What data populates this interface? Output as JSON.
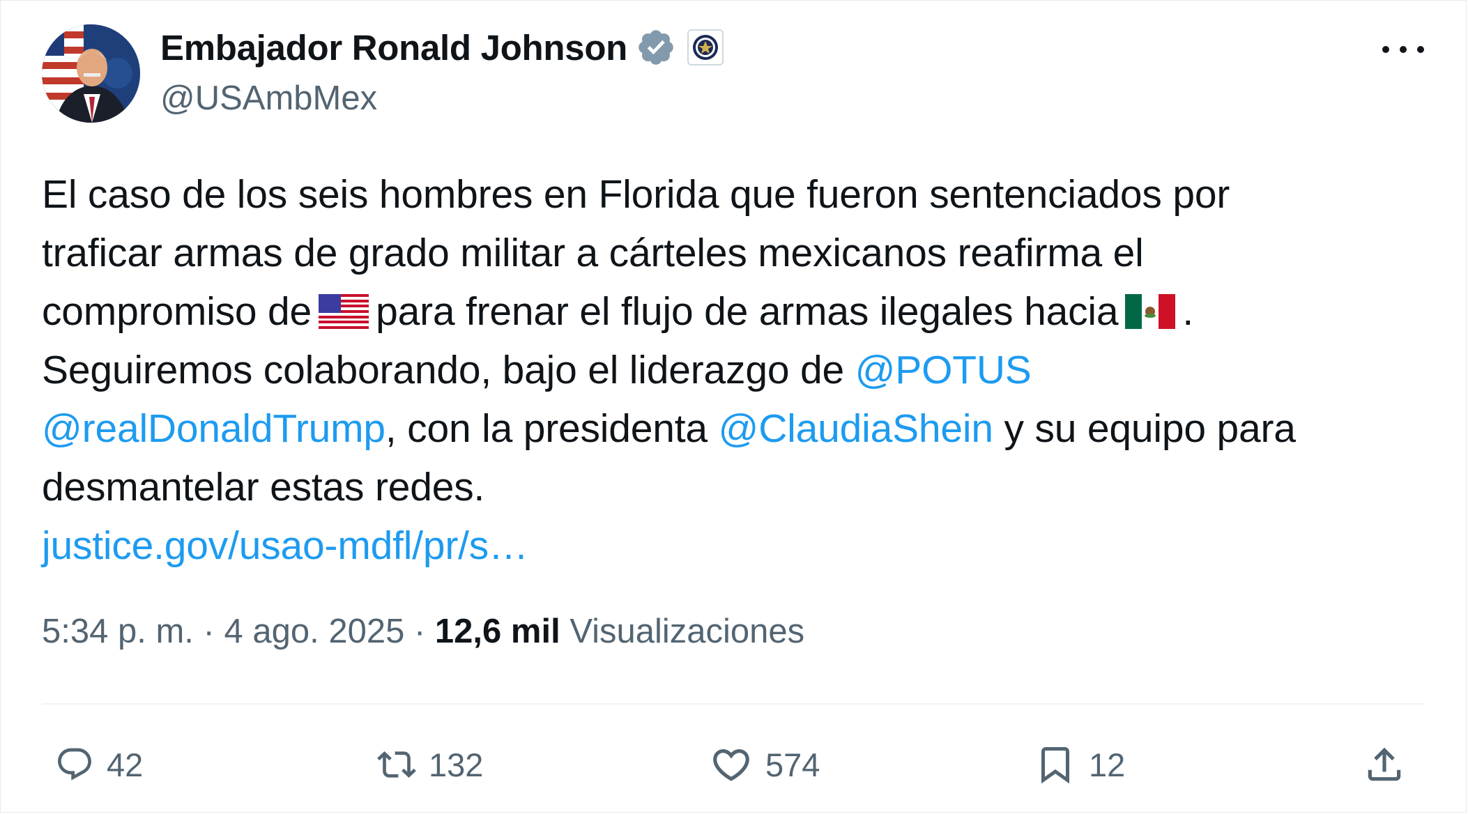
{
  "author": {
    "display_name": "Embajador Ronald Johnson",
    "handle": "@USAmbMex",
    "verified_icon": "verified-badge-icon",
    "affiliation_icon": "state-department-seal-icon"
  },
  "tweet": {
    "line1": "El caso de los seis hombres en Florida que fueron sentenciados por",
    "line2": "traficar armas de grado militar a cárteles mexicanos reafirma el",
    "line3_a": "compromiso de",
    "line3_b": "para frenar el flujo de armas ilegales hacia",
    "line3_c": ".",
    "line4_a": "Seguiremos colaborando, bajo el liderazgo de",
    "mention_potus": "@POTUS",
    "mention_trump": "@realDonaldTrump",
    "line5_b": ", con la presidenta",
    "mention_claudia": "@ClaudiaShein",
    "line5_d": "y su equipo para",
    "line6": "desmantelar estas redes.",
    "url": "justice.gov/usao-mdfl/pr/s…"
  },
  "meta": {
    "time": "5:34 p. m.",
    "sep1": "·",
    "date": "4 ago. 2025",
    "sep2": "·",
    "views_count": "12,6 mil",
    "views_label": "Visualizaciones"
  },
  "actions": {
    "replies": "42",
    "reposts": "132",
    "likes": "574",
    "bookmarks": "12"
  },
  "colors": {
    "link": "#1d9bf0",
    "secondary_text": "#536471",
    "verified": "#829aab"
  }
}
